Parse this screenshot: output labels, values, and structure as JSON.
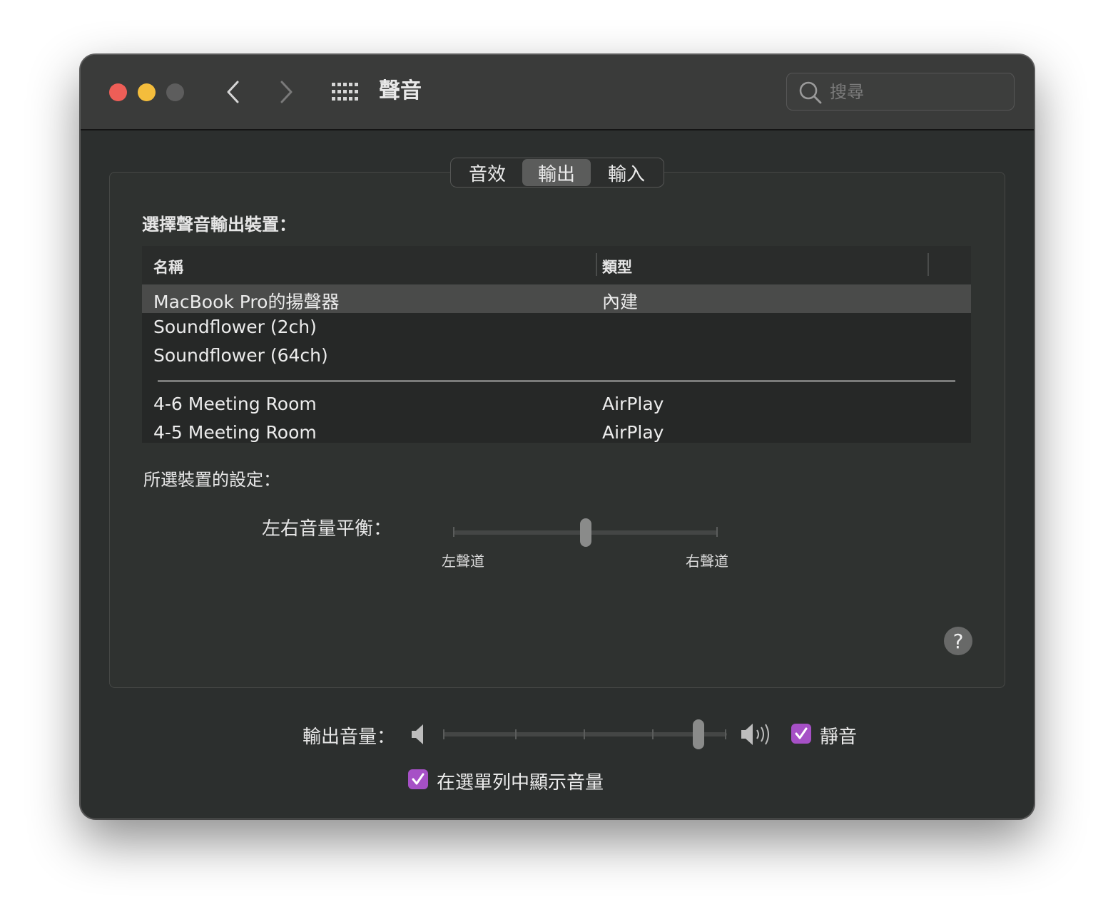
{
  "window": {
    "title": "聲音",
    "search_placeholder": "搜尋"
  },
  "tabs": [
    {
      "label": "音效",
      "selected": false
    },
    {
      "label": "輸出",
      "selected": true
    },
    {
      "label": "輸入",
      "selected": false
    }
  ],
  "output": {
    "choose_label": "選擇聲音輸出裝置：",
    "columns": {
      "name": "名稱",
      "type": "類型"
    },
    "devices": [
      {
        "name": "MacBook Pro的揚聲器",
        "type": "內建",
        "selected": true
      },
      {
        "name": "Soundflower (2ch)",
        "type": ""
      },
      {
        "name": "Soundflower (64ch)",
        "type": ""
      },
      {
        "name": "4-6 Meeting Room",
        "type": "AirPlay"
      },
      {
        "name": "4-5 Meeting Room",
        "type": "AirPlay"
      }
    ],
    "settings_label": "所選裝置的設定：",
    "balance": {
      "label": "左右音量平衡：",
      "left_label": "左聲道",
      "right_label": "右聲道",
      "value": 0.5
    },
    "help": "?"
  },
  "volume": {
    "label": "輸出音量：",
    "value": 0.9,
    "mute_label": "靜音",
    "mute_checked": true,
    "menubar_label": "在選單列中顯示音量",
    "menubar_checked": true
  },
  "colors": {
    "close": "#ee5e57",
    "minimize": "#f4bd3c",
    "maximize": "#5d5d5d",
    "checkbox_accent": "#a650c6",
    "selected_row": "#4a4b4a"
  },
  "icons": {
    "back": "chevron-left-icon",
    "forward": "chevron-right-icon",
    "grid": "grid-icon",
    "search": "search-icon",
    "volume_low": "speaker-low-icon",
    "volume_high": "speaker-high-icon",
    "checkmark": "checkmark-icon"
  }
}
